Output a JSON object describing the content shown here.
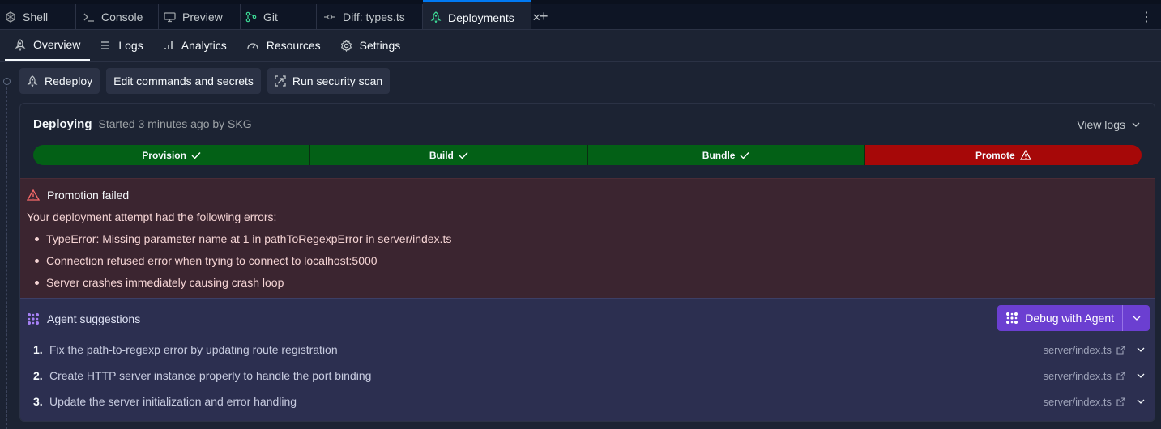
{
  "tabs": [
    {
      "label": "Shell",
      "icon": "shell-icon"
    },
    {
      "label": "Console",
      "icon": "terminal-icon"
    },
    {
      "label": "Preview",
      "icon": "monitor-icon"
    },
    {
      "label": "Git",
      "icon": "git-branch-icon"
    },
    {
      "label": "Diff: types.ts",
      "icon": "commit-icon"
    },
    {
      "label": "Deployments",
      "icon": "deployments-icon",
      "active": true
    }
  ],
  "subnav": [
    {
      "label": "Overview",
      "active": true
    },
    {
      "label": "Logs"
    },
    {
      "label": "Analytics"
    },
    {
      "label": "Resources"
    },
    {
      "label": "Settings"
    }
  ],
  "actions": {
    "redeploy": "Redeploy",
    "edit": "Edit commands and secrets",
    "scan": "Run security scan"
  },
  "deploy": {
    "status": "Deploying",
    "subtitle": "Started 3 minutes ago by SKG",
    "view_logs": "View logs",
    "stages": [
      {
        "label": "Provision",
        "state": "success",
        "color": "#036016"
      },
      {
        "label": "Build",
        "state": "success",
        "color": "#036016"
      },
      {
        "label": "Bundle",
        "state": "success",
        "color": "#036016"
      },
      {
        "label": "Promote",
        "state": "failed",
        "color": "#a60808"
      }
    ]
  },
  "error": {
    "title": "Promotion failed",
    "intro": "Your deployment attempt had the following errors:",
    "items": [
      "TypeError: Missing parameter name at 1 in pathToRegexpError in server/index.ts",
      "Connection refused error when trying to connect to localhost:5000",
      "Server crashes immediately causing crash loop"
    ]
  },
  "agent": {
    "title": "Agent suggestions",
    "debug_label": "Debug with Agent",
    "suggestions": [
      {
        "num": "1.",
        "text": "Fix the path-to-regexp error by updating route registration",
        "file": "server/index.ts"
      },
      {
        "num": "2.",
        "text": "Create HTTP server instance properly to handle the port binding",
        "file": "server/index.ts"
      },
      {
        "num": "3.",
        "text": "Update the server initialization and error handling",
        "file": "server/index.ts"
      }
    ]
  },
  "colors": {
    "accent_purple": "#6b3fd1",
    "success": "#036016",
    "danger": "#a60808"
  }
}
